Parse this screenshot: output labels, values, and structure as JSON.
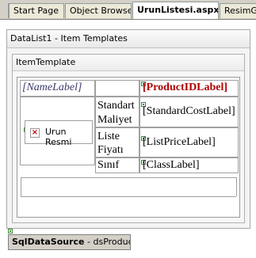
{
  "tabs": [
    {
      "label": "Start Page"
    },
    {
      "label": "Object Browser"
    },
    {
      "label": "UrunListesi.aspx"
    },
    {
      "label": "ResimGo"
    }
  ],
  "datalist": {
    "header": "DataList1 - Item Templates",
    "template_header": "ItemTemplate"
  },
  "template": {
    "name_label": "[NameLabel]",
    "productid_label": "[ProductIDLabel]",
    "image_alt": "Urun Resmi",
    "rows": [
      {
        "caption": "Standart Maliyet",
        "value": "[StandardCostLabel]"
      },
      {
        "caption": "Liste Fiyatı",
        "value": "[ListPriceLabel]"
      },
      {
        "caption": "Sınıf",
        "value": "[ClassLabel]"
      }
    ]
  },
  "datasource": {
    "type": "SqlDataSource",
    "name": "dsProducts"
  }
}
